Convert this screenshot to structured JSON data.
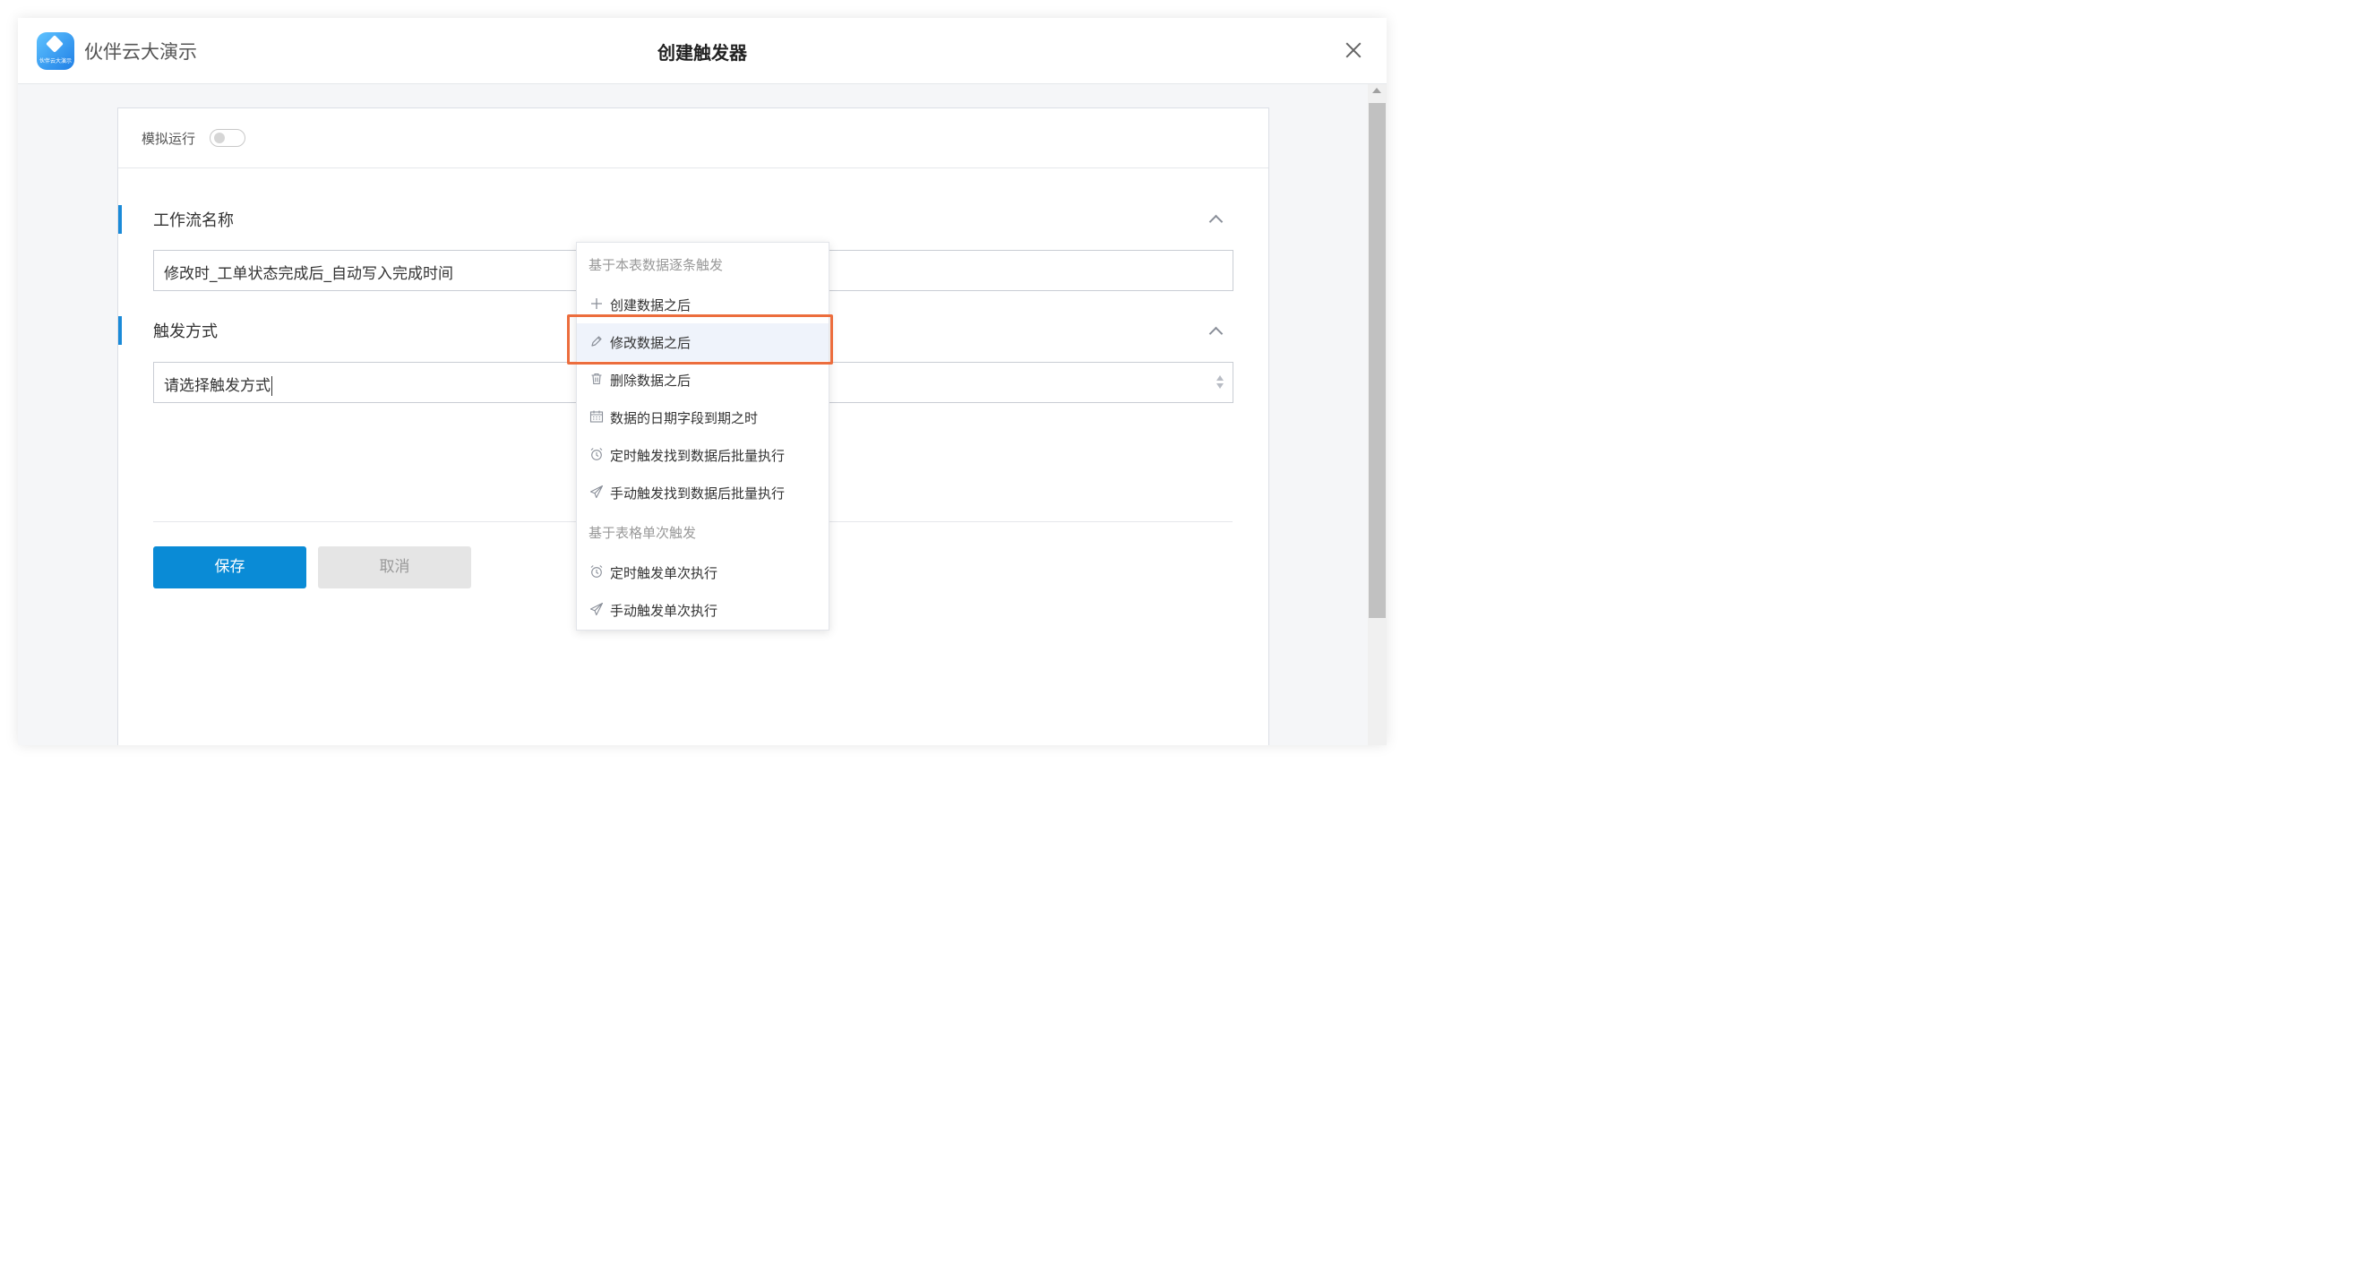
{
  "app": {
    "name": "伙伴云大演示",
    "logo_text": "伙伴云大演示"
  },
  "dialog": {
    "title": "创建触发器"
  },
  "simulation": {
    "label": "模拟运行",
    "enabled": false
  },
  "workflow_name": {
    "section_title": "工作流名称",
    "value": "修改时_工单状态完成后_自动写入完成时间"
  },
  "trigger": {
    "section_title": "触发方式",
    "value": "请选择触发方式"
  },
  "buttons": {
    "save": "保存",
    "cancel": "取消"
  },
  "dropdown": {
    "groups": [
      {
        "label": "基于本表数据逐条触发",
        "items": [
          {
            "label": "创建数据之后",
            "icon": "plus-icon"
          },
          {
            "label": "修改数据之后",
            "icon": "pencil-icon",
            "highlighted": true
          },
          {
            "label": "删除数据之后",
            "icon": "trash-icon"
          },
          {
            "label": "数据的日期字段到期之时",
            "icon": "calendar-icon"
          },
          {
            "label": "定时触发找到数据后批量执行",
            "icon": "alarm-clock-icon"
          },
          {
            "label": "手动触发找到数据后批量执行",
            "icon": "paper-plane-icon"
          }
        ]
      },
      {
        "label": "基于表格单次触发",
        "items": [
          {
            "label": "定时触发单次执行",
            "icon": "alarm-clock-icon"
          },
          {
            "label": "手动触发单次执行",
            "icon": "paper-plane-icon"
          }
        ]
      }
    ]
  },
  "colors": {
    "primary": "#0a8bd6",
    "section_accent": "#1a8ad8",
    "annotation": "#ec6d3d"
  }
}
